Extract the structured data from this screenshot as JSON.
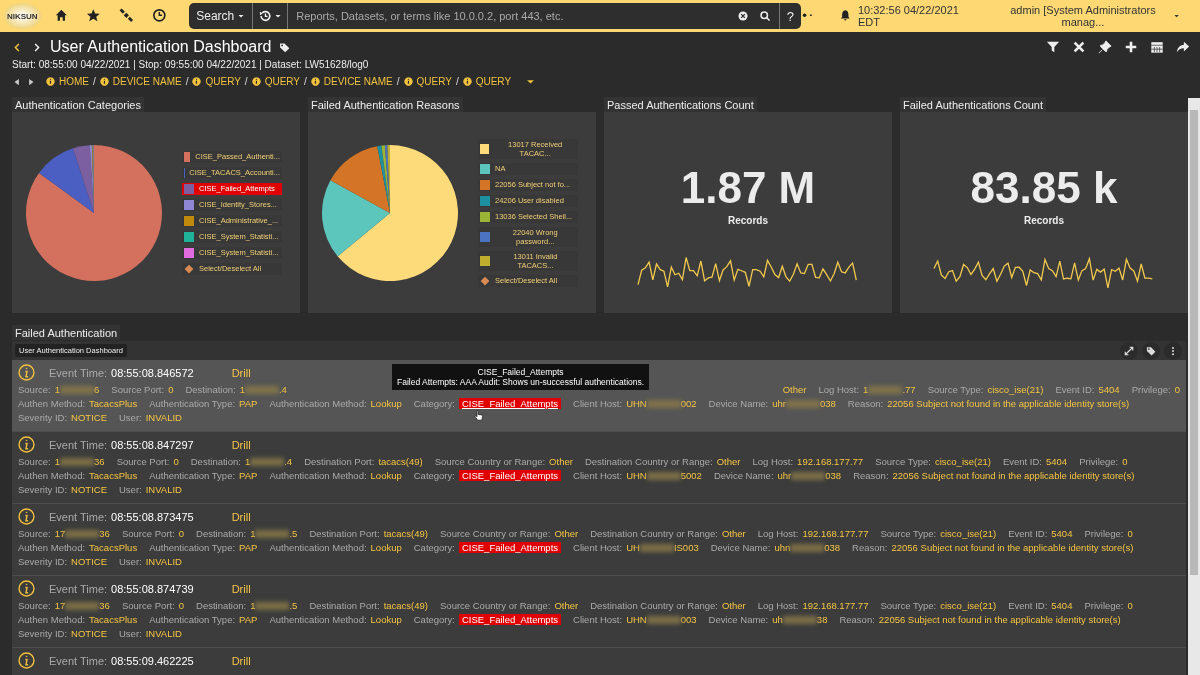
{
  "top_bar": {
    "logo": "NIKSUN",
    "search_menu": "Search",
    "search_placeholder": "Reports, Datasets, or terms like 10.0.0.2, port 443, etc.",
    "help": "?",
    "clock": "10:32:56 04/22/2021 EDT",
    "user": "admin [System Administrators manag..."
  },
  "header": {
    "title": "User Authentication Dashboard",
    "info": "Start: 08:55:00 04/22/2021 | Stop: 09:55:00 04/22/2021 | Dataset: LW51628/log0",
    "breadcrumbs": [
      {
        "label": "HOME"
      },
      {
        "separator": "/",
        "label": "DEVICE NAME"
      },
      {
        "separator": "/",
        "label": "QUERY"
      },
      {
        "separator": "/",
        "label": "QUERY"
      },
      {
        "separator": "/",
        "label": "DEVICE NAME"
      },
      {
        "separator": "/",
        "label": "QUERY"
      },
      {
        "separator": "/",
        "label": "QUERY"
      }
    ]
  },
  "pie_panels": [
    {
      "title": "Authentication Categories",
      "legend": [
        {
          "kind": "series",
          "label": "CISE_Passed_Authenti...",
          "color": "#d4705e",
          "highlighted": false
        },
        {
          "kind": "series",
          "label": "CISE_TACACS_Accounti...",
          "color": "#4b5fc2",
          "highlighted": false
        },
        {
          "kind": "series",
          "label": "CISE_Failed_Attempts",
          "color": "#7b5fa0",
          "highlighted": true
        },
        {
          "kind": "series",
          "label": "CISE_Identity_Stores...",
          "color": "#8f86d4",
          "highlighted": false
        },
        {
          "kind": "series",
          "label": "CISE_Administrative_...",
          "color": "#c08a0c",
          "highlighted": false
        },
        {
          "kind": "series",
          "label": "CISE_System_Statisti...",
          "color": "#1fb39a",
          "highlighted": false
        },
        {
          "kind": "series",
          "label": "CISE_System_Statisti...",
          "color": "#e26be0",
          "highlighted": false
        },
        {
          "kind": "toggle",
          "label": "Select/Deselect All",
          "highlighted": false
        }
      ]
    },
    {
      "title": "Failed Authentication Reasons",
      "legend": [
        {
          "kind": "series",
          "label": "13017 Received TACAC...",
          "color": "#fedb7a",
          "highlighted": false
        },
        {
          "kind": "series",
          "label": "NA",
          "color": "#5cc6bd",
          "highlighted": false
        },
        {
          "kind": "series",
          "label": "22056 Subject not fo...",
          "color": "#d47426",
          "highlighted": false
        },
        {
          "kind": "series",
          "label": "24206 User disabled",
          "color": "#1c8fa0",
          "highlighted": false
        },
        {
          "kind": "series",
          "label": "13036 Selected Shell...",
          "color": "#9cb436",
          "highlighted": false
        },
        {
          "kind": "series",
          "label": "22040 Wrong password...",
          "color": "#4b73c2",
          "highlighted": false
        },
        {
          "kind": "series",
          "label": "13011 Invalid TACACS...",
          "color": "#bfae2e",
          "highlighted": false
        },
        {
          "kind": "toggle",
          "label": "Select/Deselect All",
          "highlighted": false
        }
      ]
    }
  ],
  "stat_panels": [
    {
      "title": "Passed Authentications Count",
      "value": "1.87 M",
      "unit": "Records"
    },
    {
      "title": "Failed Authentications Count",
      "value": "83.85 k",
      "unit": "Records"
    }
  ],
  "events": {
    "title": "Failed Authentication",
    "chip": "User Authentication Dashboard",
    "tooltip": {
      "title": "CISE_Failed_Attempts",
      "text": "Failed Attempts: AAA Audit: Shows un-successful authentications."
    },
    "rows": [
      {
        "hovered": true,
        "tooltip": true,
        "time_label": "Event Time:",
        "time": "08:55:08.846572",
        "drill": "Drill",
        "lines": [
          [
            {
              "label": "Source:",
              "value": "1",
              "after": "6"
            },
            {
              "label": "Source Port:",
              "value": "0"
            },
            {
              "label": "Destination:",
              "value": "1",
              "after": ".4"
            },
            {
              "kind": "covered"
            },
            {
              "kind": "covered"
            },
            {
              "value": "Other"
            },
            {
              "label": "Log Host:",
              "value": "1",
              "after": ".77"
            },
            {
              "label": "Source Type:",
              "value": "cisco_ise(21)"
            },
            {
              "label": "Event ID:",
              "value": "5404"
            },
            {
              "label": "Privilege:",
              "value": "0"
            }
          ],
          [
            {
              "label": "Authen Method:",
              "value": "TacacsPlus"
            },
            {
              "label": "Authentication Type:",
              "value": "PAP"
            },
            {
              "label": "Authentication Method:",
              "value": "Lookup"
            },
            {
              "label": "Category:",
              "value": "CISE_Failed_Attempts",
              "kind": "category"
            },
            {
              "label": "Client Host:",
              "value": "UHN",
              "after": "002"
            },
            {
              "label": "Device Name:",
              "value": "uhr",
              "after": "038"
            },
            {
              "label": "Reason:",
              "value": "22056 Subject not found in the applicable identity store(s)"
            }
          ],
          [
            {
              "label": "Severity ID:",
              "value": "NOTICE"
            },
            {
              "label": "User:",
              "value": "INVALID"
            }
          ]
        ]
      },
      {
        "hovered": false,
        "tooltip": false,
        "time_label": "Event Time:",
        "time": "08:55:08.847297",
        "drill": "Drill",
        "lines": [
          [
            {
              "label": "Source:",
              "value": "1",
              "after": "36"
            },
            {
              "label": "Source Port:",
              "value": "0"
            },
            {
              "label": "Destination:",
              "value": "1",
              "after": ".4"
            },
            {
              "label": "Destination Port:",
              "value": "tacacs(49)"
            },
            {
              "label": "Source Country or Range:",
              "value": "Other"
            },
            {
              "label": "Destination Country or Range:",
              "value": "Other"
            },
            {
              "label": "Log Host:",
              "value": "192.168.177.77"
            },
            {
              "label": "Source Type:",
              "value": "cisco_ise(21)"
            },
            {
              "label": "Event ID:",
              "value": "5404"
            },
            {
              "label": "Privilege:",
              "value": "0"
            }
          ],
          [
            {
              "label": "Authen Method:",
              "value": "TacacsPlus"
            },
            {
              "label": "Authentication Type:",
              "value": "PAP"
            },
            {
              "label": "Authentication Method:",
              "value": "Lookup"
            },
            {
              "label": "Category:",
              "value": "CISE_Failed_Attempts",
              "kind": "category"
            },
            {
              "label": "Client Host:",
              "value": "UHN",
              "after": "5002"
            },
            {
              "label": "Device Name:",
              "value": "uhr",
              "after": "038"
            },
            {
              "label": "Reason:",
              "value": "22056 Subject not found in the applicable identity store(s)"
            }
          ],
          [
            {
              "label": "Severity ID:",
              "value": "NOTICE"
            },
            {
              "label": "User:",
              "value": "INVALID"
            }
          ]
        ]
      },
      {
        "hovered": false,
        "tooltip": false,
        "time_label": "Event Time:",
        "time": "08:55:08.873475",
        "drill": "Drill",
        "lines": [
          [
            {
              "label": "Source:",
              "value": "17",
              "after": "36"
            },
            {
              "label": "Source Port:",
              "value": "0"
            },
            {
              "label": "Destination:",
              "value": "1",
              "after": ".5"
            },
            {
              "label": "Destination Port:",
              "value": "tacacs(49)"
            },
            {
              "label": "Source Country or Range:",
              "value": "Other"
            },
            {
              "label": "Destination Country or Range:",
              "value": "Other"
            },
            {
              "label": "Log Host:",
              "value": "192.168.177.77"
            },
            {
              "label": "Source Type:",
              "value": "cisco_ise(21)"
            },
            {
              "label": "Event ID:",
              "value": "5404"
            },
            {
              "label": "Privilege:",
              "value": "0"
            }
          ],
          [
            {
              "label": "Authen Method:",
              "value": "TacacsPlus"
            },
            {
              "label": "Authentication Type:",
              "value": "PAP"
            },
            {
              "label": "Authentication Method:",
              "value": "Lookup"
            },
            {
              "label": "Category:",
              "value": "CISE_Failed_Attempts",
              "kind": "category"
            },
            {
              "label": "Client Host:",
              "value": "UH",
              "after": "IS003"
            },
            {
              "label": "Device Name:",
              "value": "uhn",
              "after": "038"
            },
            {
              "label": "Reason:",
              "value": "22056 Subject not found in the applicable identity store(s)"
            }
          ],
          [
            {
              "label": "Severity ID:",
              "value": "NOTICE"
            },
            {
              "label": "User:",
              "value": "INVALID"
            }
          ]
        ]
      },
      {
        "hovered": false,
        "tooltip": false,
        "time_label": "Event Time:",
        "time": "08:55:08.874739",
        "drill": "Drill",
        "lines": [
          [
            {
              "label": "Source:",
              "value": "17",
              "after": "36"
            },
            {
              "label": "Source Port:",
              "value": "0"
            },
            {
              "label": "Destination:",
              "value": "1",
              "after": ".5"
            },
            {
              "label": "Destination Port:",
              "value": "tacacs(49)"
            },
            {
              "label": "Source Country or Range:",
              "value": "Other"
            },
            {
              "label": "Destination Country or Range:",
              "value": "Other"
            },
            {
              "label": "Log Host:",
              "value": "192.168.177.77"
            },
            {
              "label": "Source Type:",
              "value": "cisco_ise(21)"
            },
            {
              "label": "Event ID:",
              "value": "5404"
            },
            {
              "label": "Privilege:",
              "value": "0"
            }
          ],
          [
            {
              "label": "Authen Method:",
              "value": "TacacsPlus"
            },
            {
              "label": "Authentication Type:",
              "value": "PAP"
            },
            {
              "label": "Authentication Method:",
              "value": "Lookup"
            },
            {
              "label": "Category:",
              "value": "CISE_Failed_Attempts",
              "kind": "category"
            },
            {
              "label": "Client Host:",
              "value": "UHN",
              "after": "003"
            },
            {
              "label": "Device Name:",
              "value": "uh",
              "after": "38"
            },
            {
              "label": "Reason:",
              "value": "22056 Subject not found in the applicable identity store(s)"
            }
          ],
          [
            {
              "label": "Severity ID:",
              "value": "NOTICE"
            },
            {
              "label": "User:",
              "value": "INVALID"
            }
          ]
        ]
      },
      {
        "hovered": false,
        "tooltip": false,
        "time_label": "Event Time:",
        "time": "08:55:09.462225",
        "drill": "Drill",
        "lines": []
      }
    ]
  }
}
